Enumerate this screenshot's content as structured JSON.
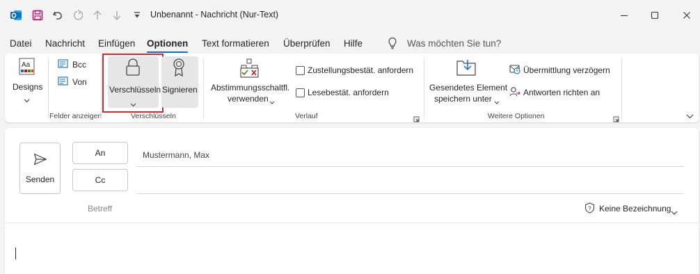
{
  "titlebar": {
    "title": "Unbenannt  -  Nachricht (Nur-Text)",
    "icons": [
      "outlook-app-icon",
      "save-icon",
      "undo-icon",
      "redo-icon",
      "up-arrow-icon",
      "down-arrow-icon",
      "customize-qat-icon"
    ],
    "window_controls": [
      "minimize-icon",
      "maximize-icon",
      "close-icon"
    ]
  },
  "menu": {
    "items": [
      "Datei",
      "Nachricht",
      "Einfügen",
      "Optionen",
      "Text formatieren",
      "Überprüfen",
      "Hilfe"
    ],
    "active": "Optionen",
    "search_label": "Was möchten Sie tun?"
  },
  "ribbon": {
    "designs": "Designs",
    "bcc": "Bcc",
    "von": "Von",
    "felder_group": "Felder anzeigen",
    "verschluesseln": "Verschlüsseln",
    "signieren": "Signieren",
    "verschluesseln_group": "Verschlüsseln",
    "abstimmung_line1": "Abstimmungsschaltfl.",
    "abstimmung_line2": "verwenden",
    "zustellung": "Zustellungsbestät. anfordern",
    "lesebest": "Lesebestät. anfordern",
    "verlauf_group": "Verlauf",
    "gesendetes_line1": "Gesendetes Element",
    "gesendetes_line2": "speichern unter",
    "verzoegern": "Übermittlung verzögern",
    "antworten": "Antworten richten an",
    "weitere_group": "Weitere Optionen",
    "accent_color": "#0f6cbd",
    "highlight_color": "#d62828"
  },
  "compose": {
    "send": "Senden",
    "to_button": "An",
    "cc_button": "Cc",
    "to_value": "Mustermann, Max",
    "subject_label": "Betreff",
    "sensitivity": "Keine Bezeichnung"
  }
}
